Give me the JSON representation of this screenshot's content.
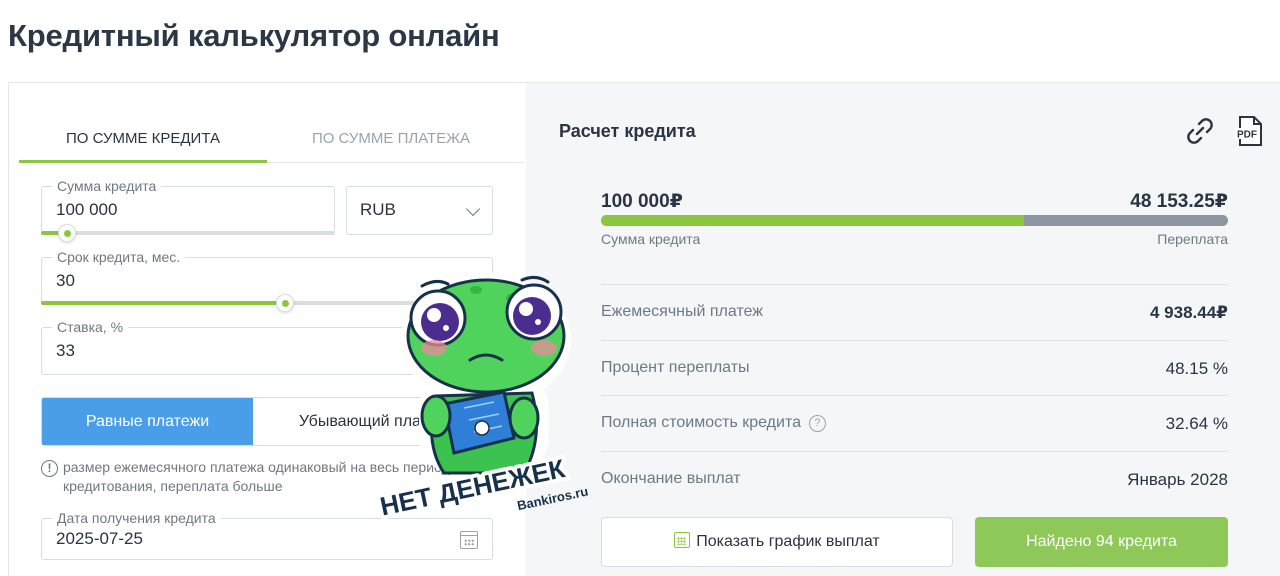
{
  "page": {
    "title": "Кредитный калькулятор онлайн"
  },
  "tabs": [
    {
      "label": "ПО СУММЕ КРЕДИТА",
      "active": true
    },
    {
      "label": "ПО СУММЕ ПЛАТЕЖА",
      "active": false
    }
  ],
  "form": {
    "amount": {
      "label": "Сумма кредита",
      "value": "100 000",
      "slider_fraction": 0.09
    },
    "currency": {
      "value": "RUB"
    },
    "term": {
      "label": "Срок кредита, мес.",
      "value": "30",
      "slider_fraction": 0.54
    },
    "rate": {
      "label": "Ставка, %",
      "value": "33"
    },
    "payment_type": {
      "options": [
        "Равные платежи",
        "Убывающий платеж"
      ],
      "selected": "Равные платежи",
      "visible_inactive": "Убывающий пла"
    },
    "hint": "размер ежемесячного платежа одинаковый на весь период кредитования, переплата больше",
    "date": {
      "label": "Дата получения кредита",
      "value": "2025-07-25"
    }
  },
  "result": {
    "title": "Расчет кредита",
    "icons": [
      "link-icon",
      "pdf-icon"
    ],
    "pdf_label": "PDF",
    "principal": {
      "value": "100 000₽",
      "label": "Сумма кредита"
    },
    "overpayment": {
      "value": "48 153.25₽",
      "label": "Переплата"
    },
    "principal_fraction": 0.675,
    "rows": [
      {
        "label": "Ежемесячный платеж",
        "value": "4 938.44₽"
      },
      {
        "label": "Процент переплаты",
        "value": "48.15 %"
      },
      {
        "label": "Полная стоимость кредита",
        "value": "32.64 %"
      },
      {
        "label": "Окончание выплат",
        "value": "Январь 2028"
      }
    ],
    "schedule_button": "Показать график выплат",
    "found_button": "Найдено 94 кредита"
  },
  "sticker": {
    "line1": "НЕТ",
    "line2": "ДЕНЕЖЕК",
    "site": "Bankiros.ru"
  },
  "colors": {
    "accent_green": "#8cc63f",
    "accent_blue": "#4a9ee8",
    "text": "#2b3442",
    "muted": "#6f7883"
  }
}
